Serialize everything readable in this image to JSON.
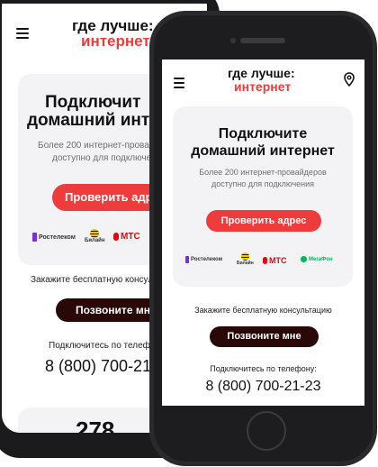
{
  "header": {
    "menu_icon": "hamburger-icon",
    "logo_line1": "где лучше:",
    "logo_line2": "интернет",
    "location_icon": "map-pin-icon"
  },
  "hero": {
    "title_line1": "Подключите",
    "title_line2": "домашний интернет",
    "subtitle_line1": "Более 200 интернет-провайдеров",
    "subtitle_line2": "доступно для подключения",
    "check_button": "Проверить адрес"
  },
  "providers": [
    {
      "name": "Ростелеком",
      "color": "#7a30d8",
      "icon": "rostelecom-logo"
    },
    {
      "name": "Билайн",
      "color": "#f5c400",
      "icon": "beeline-logo"
    },
    {
      "name": "МТС",
      "color": "#e30611",
      "icon": "mts-logo"
    },
    {
      "name": "МегаФон",
      "color": "#00b956",
      "icon": "megafon-logo"
    }
  ],
  "back_screen": {
    "title_line1": "Подключит",
    "title_line2": "домашний инте",
    "subtitle_line1": "Более 200 интернет-прова",
    "subtitle_line2": "доступно для подключе",
    "check_button": "Проверить адре",
    "consult_text": "Закажите бесплатную консульта",
    "phone_intro": "Подключитесь по телефо",
    "phone_number": "8 (800) 700-21",
    "stat_number": "278"
  },
  "consult": {
    "text": "Закажите бесплатную консультацию",
    "call_button": "Позвоните мне"
  },
  "phone": {
    "intro": "Подключитесь по телефону:",
    "number": "8 (800) 700-21-23"
  },
  "colors": {
    "accent_red": "#ee3b3b",
    "dark_button": "#2a0808",
    "card_bg": "#f3f3f5",
    "phone_body": "#1d1d1f"
  }
}
